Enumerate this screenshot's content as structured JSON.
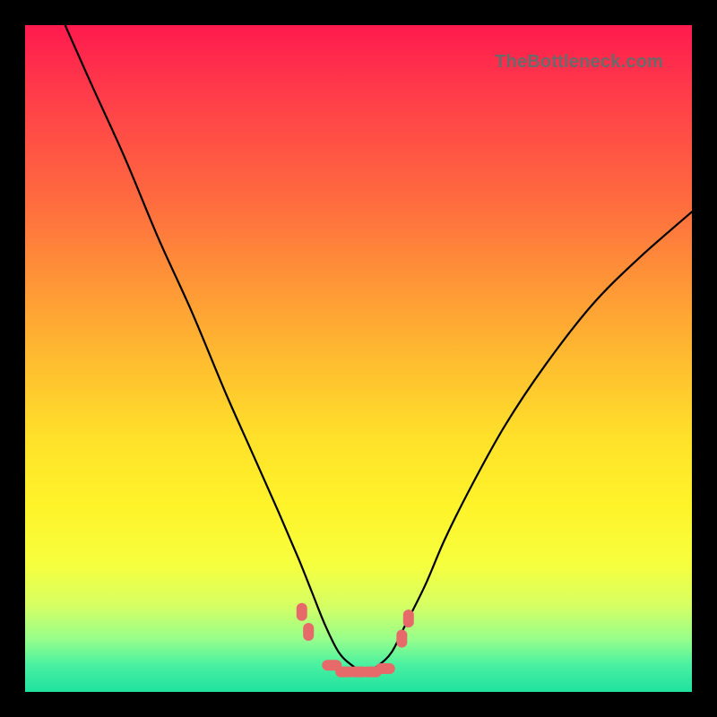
{
  "watermark": "TheBottleneck.com",
  "colors": {
    "frame": "#000000",
    "curve": "#000000",
    "marker": "#e66a6a",
    "gradient_stops": [
      "#ff1a4e",
      "#ff3b4a",
      "#ff6a3f",
      "#ff9a36",
      "#ffc22f",
      "#ffe12a",
      "#fff32a",
      "#f6ff3e",
      "#d6ff63",
      "#98ff8b",
      "#49f0a1",
      "#1fe2a0"
    ]
  },
  "chart_data": {
    "type": "line",
    "title": "",
    "xlabel": "",
    "ylabel": "",
    "xlim": [
      0,
      100
    ],
    "ylim": [
      0,
      100
    ],
    "grid": false,
    "legend": false,
    "note": "Axes are unlabeled; values are estimated from pixel positions on a 0–100 scale for each axis (0 at bottom/left). Curve shows a deep V/U-shaped profile with minimum near x≈48–54.",
    "series": [
      {
        "name": "curve",
        "x": [
          6,
          10,
          15,
          20,
          25,
          30,
          34,
          38,
          41,
          43,
          45,
          47,
          49,
          51,
          53,
          55,
          57,
          60,
          63,
          67,
          72,
          78,
          85,
          92,
          100
        ],
        "y": [
          100,
          91,
          80,
          68,
          57,
          45,
          36,
          27,
          20,
          15,
          10,
          6,
          4,
          3,
          4,
          6,
          10,
          16,
          23,
          31,
          40,
          49,
          58,
          65,
          72
        ]
      }
    ],
    "markers": {
      "name": "highlighted-points",
      "x": [
        41.5,
        42.5,
        46,
        48,
        50,
        52,
        54,
        56.5,
        57.5
      ],
      "y": [
        12,
        9,
        4,
        3,
        3,
        3,
        3.5,
        8,
        11
      ]
    }
  }
}
